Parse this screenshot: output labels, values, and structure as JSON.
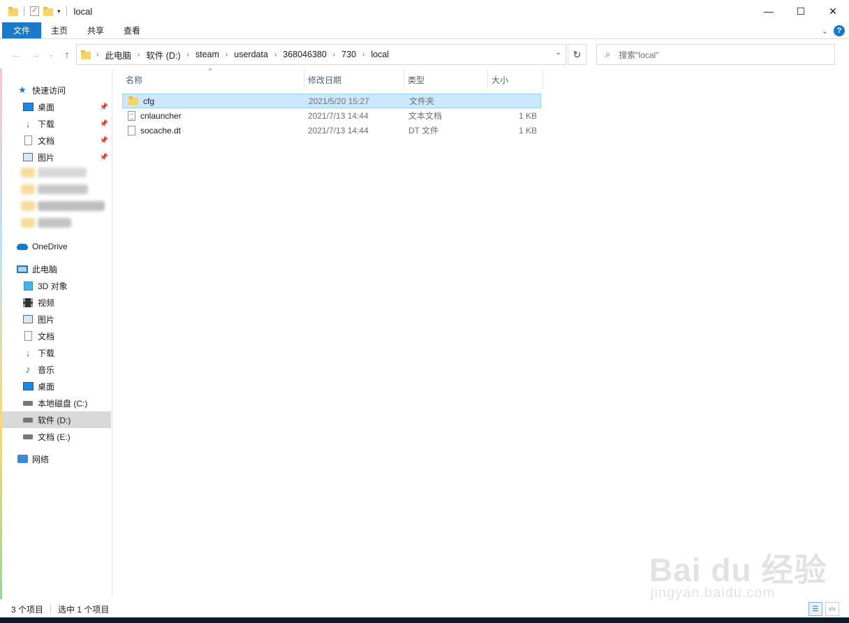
{
  "window": {
    "title": "local",
    "minimize": "—",
    "maximize": "☐",
    "close": "✕"
  },
  "ribbon": {
    "tabs": [
      "文件",
      "主页",
      "共享",
      "查看"
    ],
    "expand_icon": "chevron-down",
    "help": "?"
  },
  "nav": {
    "back": "←",
    "forward": "→",
    "recent": "⌄",
    "up": "↑"
  },
  "address": {
    "crumbs": [
      "此电脑",
      "软件 (D:)",
      "steam",
      "userdata",
      "368046380",
      "730",
      "local"
    ]
  },
  "search": {
    "placeholder": "搜索\"local\""
  },
  "navpane": {
    "quick_access": "快速访问",
    "quick_items": [
      "桌面",
      "下载",
      "文档",
      "图片"
    ],
    "onedrive": "OneDrive",
    "this_pc": "此电脑",
    "pc_items": [
      "3D 对象",
      "视频",
      "图片",
      "文档",
      "下载",
      "音乐",
      "桌面",
      "本地磁盘 (C:)",
      "软件 (D:)",
      "文档 (E:)"
    ],
    "network": "网络",
    "selected": "软件 (D:)"
  },
  "columns": {
    "name": "名称",
    "date": "修改日期",
    "type": "类型",
    "size": "大小"
  },
  "files": [
    {
      "name": "cfg",
      "date": "2021/5/20 15:27",
      "type": "文件夹",
      "size": "",
      "kind": "folder",
      "selected": true
    },
    {
      "name": "cnlauncher",
      "date": "2021/7/13 14:44",
      "type": "文本文档",
      "size": "1 KB",
      "kind": "text",
      "selected": false
    },
    {
      "name": "socache.dt",
      "date": "2021/7/13 14:44",
      "type": "DT 文件",
      "size": "1 KB",
      "kind": "file",
      "selected": false
    }
  ],
  "status": {
    "count": "3 个项目",
    "selected": "选中 1 个项目"
  },
  "watermark": {
    "main": "Bai du 经验",
    "sub": "jingyan.baidu.com"
  },
  "colors": {
    "accent": "#1979ca",
    "selection_bg": "#cce8ff",
    "selection_border": "#99d1ff",
    "nav_selected": "#d9d9d9"
  }
}
